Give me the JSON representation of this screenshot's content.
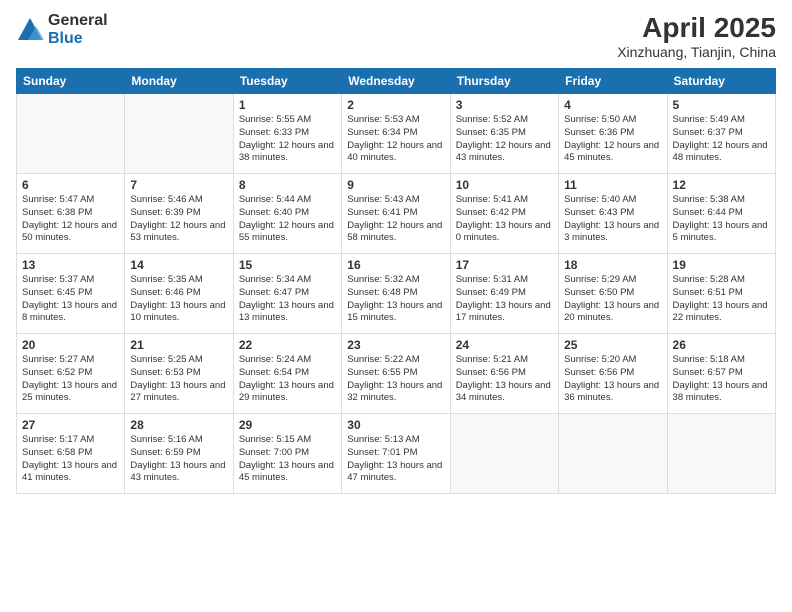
{
  "logo": {
    "general": "General",
    "blue": "Blue"
  },
  "title": "April 2025",
  "location": "Xinzhuang, Tianjin, China",
  "days_of_week": [
    "Sunday",
    "Monday",
    "Tuesday",
    "Wednesday",
    "Thursday",
    "Friday",
    "Saturday"
  ],
  "weeks": [
    [
      {
        "day": "",
        "info": ""
      },
      {
        "day": "",
        "info": ""
      },
      {
        "day": "1",
        "info": "Sunrise: 5:55 AM\nSunset: 6:33 PM\nDaylight: 12 hours and 38 minutes."
      },
      {
        "day": "2",
        "info": "Sunrise: 5:53 AM\nSunset: 6:34 PM\nDaylight: 12 hours and 40 minutes."
      },
      {
        "day": "3",
        "info": "Sunrise: 5:52 AM\nSunset: 6:35 PM\nDaylight: 12 hours and 43 minutes."
      },
      {
        "day": "4",
        "info": "Sunrise: 5:50 AM\nSunset: 6:36 PM\nDaylight: 12 hours and 45 minutes."
      },
      {
        "day": "5",
        "info": "Sunrise: 5:49 AM\nSunset: 6:37 PM\nDaylight: 12 hours and 48 minutes."
      }
    ],
    [
      {
        "day": "6",
        "info": "Sunrise: 5:47 AM\nSunset: 6:38 PM\nDaylight: 12 hours and 50 minutes."
      },
      {
        "day": "7",
        "info": "Sunrise: 5:46 AM\nSunset: 6:39 PM\nDaylight: 12 hours and 53 minutes."
      },
      {
        "day": "8",
        "info": "Sunrise: 5:44 AM\nSunset: 6:40 PM\nDaylight: 12 hours and 55 minutes."
      },
      {
        "day": "9",
        "info": "Sunrise: 5:43 AM\nSunset: 6:41 PM\nDaylight: 12 hours and 58 minutes."
      },
      {
        "day": "10",
        "info": "Sunrise: 5:41 AM\nSunset: 6:42 PM\nDaylight: 13 hours and 0 minutes."
      },
      {
        "day": "11",
        "info": "Sunrise: 5:40 AM\nSunset: 6:43 PM\nDaylight: 13 hours and 3 minutes."
      },
      {
        "day": "12",
        "info": "Sunrise: 5:38 AM\nSunset: 6:44 PM\nDaylight: 13 hours and 5 minutes."
      }
    ],
    [
      {
        "day": "13",
        "info": "Sunrise: 5:37 AM\nSunset: 6:45 PM\nDaylight: 13 hours and 8 minutes."
      },
      {
        "day": "14",
        "info": "Sunrise: 5:35 AM\nSunset: 6:46 PM\nDaylight: 13 hours and 10 minutes."
      },
      {
        "day": "15",
        "info": "Sunrise: 5:34 AM\nSunset: 6:47 PM\nDaylight: 13 hours and 13 minutes."
      },
      {
        "day": "16",
        "info": "Sunrise: 5:32 AM\nSunset: 6:48 PM\nDaylight: 13 hours and 15 minutes."
      },
      {
        "day": "17",
        "info": "Sunrise: 5:31 AM\nSunset: 6:49 PM\nDaylight: 13 hours and 17 minutes."
      },
      {
        "day": "18",
        "info": "Sunrise: 5:29 AM\nSunset: 6:50 PM\nDaylight: 13 hours and 20 minutes."
      },
      {
        "day": "19",
        "info": "Sunrise: 5:28 AM\nSunset: 6:51 PM\nDaylight: 13 hours and 22 minutes."
      }
    ],
    [
      {
        "day": "20",
        "info": "Sunrise: 5:27 AM\nSunset: 6:52 PM\nDaylight: 13 hours and 25 minutes."
      },
      {
        "day": "21",
        "info": "Sunrise: 5:25 AM\nSunset: 6:53 PM\nDaylight: 13 hours and 27 minutes."
      },
      {
        "day": "22",
        "info": "Sunrise: 5:24 AM\nSunset: 6:54 PM\nDaylight: 13 hours and 29 minutes."
      },
      {
        "day": "23",
        "info": "Sunrise: 5:22 AM\nSunset: 6:55 PM\nDaylight: 13 hours and 32 minutes."
      },
      {
        "day": "24",
        "info": "Sunrise: 5:21 AM\nSunset: 6:56 PM\nDaylight: 13 hours and 34 minutes."
      },
      {
        "day": "25",
        "info": "Sunrise: 5:20 AM\nSunset: 6:56 PM\nDaylight: 13 hours and 36 minutes."
      },
      {
        "day": "26",
        "info": "Sunrise: 5:18 AM\nSunset: 6:57 PM\nDaylight: 13 hours and 38 minutes."
      }
    ],
    [
      {
        "day": "27",
        "info": "Sunrise: 5:17 AM\nSunset: 6:58 PM\nDaylight: 13 hours and 41 minutes."
      },
      {
        "day": "28",
        "info": "Sunrise: 5:16 AM\nSunset: 6:59 PM\nDaylight: 13 hours and 43 minutes."
      },
      {
        "day": "29",
        "info": "Sunrise: 5:15 AM\nSunset: 7:00 PM\nDaylight: 13 hours and 45 minutes."
      },
      {
        "day": "30",
        "info": "Sunrise: 5:13 AM\nSunset: 7:01 PM\nDaylight: 13 hours and 47 minutes."
      },
      {
        "day": "",
        "info": ""
      },
      {
        "day": "",
        "info": ""
      },
      {
        "day": "",
        "info": ""
      }
    ]
  ]
}
